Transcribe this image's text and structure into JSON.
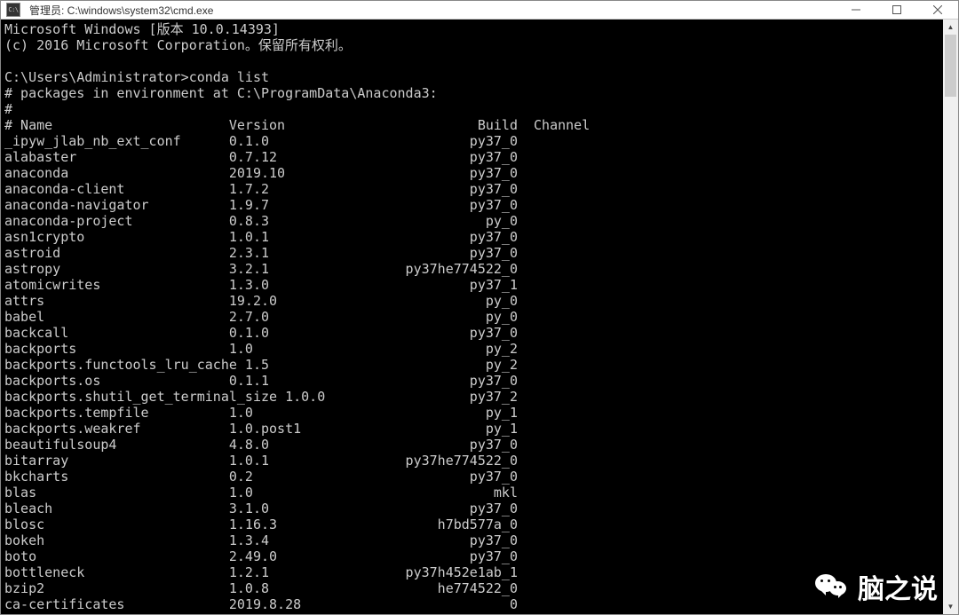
{
  "titlebar": {
    "icon_label": "C:\\",
    "title": "管理员: C:\\windows\\system32\\cmd.exe"
  },
  "terminal": {
    "banner_line1": "Microsoft Windows [版本 10.0.14393]",
    "banner_line2": "(c) 2016 Microsoft Corporation。保留所有权利。",
    "prompt": "C:\\Users\\Administrator>",
    "command": "conda list",
    "env_header": "# packages in environment at C:\\ProgramData\\Anaconda3:",
    "hash": "#",
    "col_name": "# Name",
    "col_version": "Version",
    "col_build": "Build",
    "col_channel": "Channel",
    "packages": [
      {
        "name": "_ipyw_jlab_nb_ext_conf",
        "version": "0.1.0",
        "build": "py37_0"
      },
      {
        "name": "alabaster",
        "version": "0.7.12",
        "build": "py37_0"
      },
      {
        "name": "anaconda",
        "version": "2019.10",
        "build": "py37_0"
      },
      {
        "name": "anaconda-client",
        "version": "1.7.2",
        "build": "py37_0"
      },
      {
        "name": "anaconda-navigator",
        "version": "1.9.7",
        "build": "py37_0"
      },
      {
        "name": "anaconda-project",
        "version": "0.8.3",
        "build": "py_0"
      },
      {
        "name": "asn1crypto",
        "version": "1.0.1",
        "build": "py37_0"
      },
      {
        "name": "astroid",
        "version": "2.3.1",
        "build": "py37_0"
      },
      {
        "name": "astropy",
        "version": "3.2.1",
        "build": "py37he774522_0"
      },
      {
        "name": "atomicwrites",
        "version": "1.3.0",
        "build": "py37_1"
      },
      {
        "name": "attrs",
        "version": "19.2.0",
        "build": "py_0"
      },
      {
        "name": "babel",
        "version": "2.7.0",
        "build": "py_0"
      },
      {
        "name": "backcall",
        "version": "0.1.0",
        "build": "py37_0"
      },
      {
        "name": "backports",
        "version": "1.0",
        "build": "py_2"
      },
      {
        "name": "backports.functools_lru_cache",
        "version": "1.5",
        "build": "py_2"
      },
      {
        "name": "backports.os",
        "version": "0.1.1",
        "build": "py37_0"
      },
      {
        "name": "backports.shutil_get_terminal_size",
        "version": "1.0.0",
        "build": "py37_2"
      },
      {
        "name": "backports.tempfile",
        "version": "1.0",
        "build": "py_1"
      },
      {
        "name": "backports.weakref",
        "version": "1.0.post1",
        "build": "py_1"
      },
      {
        "name": "beautifulsoup4",
        "version": "4.8.0",
        "build": "py37_0"
      },
      {
        "name": "bitarray",
        "version": "1.0.1",
        "build": "py37he774522_0"
      },
      {
        "name": "bkcharts",
        "version": "0.2",
        "build": "py37_0"
      },
      {
        "name": "blas",
        "version": "1.0",
        "build": "mkl"
      },
      {
        "name": "bleach",
        "version": "3.1.0",
        "build": "py37_0"
      },
      {
        "name": "blosc",
        "version": "1.16.3",
        "build": "h7bd577a_0"
      },
      {
        "name": "bokeh",
        "version": "1.3.4",
        "build": "py37_0"
      },
      {
        "name": "boto",
        "version": "2.49.0",
        "build": "py37_0"
      },
      {
        "name": "bottleneck",
        "version": "1.2.1",
        "build": "py37h452e1ab_1"
      },
      {
        "name": "bzip2",
        "version": "1.0.8",
        "build": "he774522_0"
      },
      {
        "name": "ca-certificates",
        "version": "2019.8.28",
        "build": "0"
      }
    ]
  },
  "watermark": {
    "text": "脑之说"
  }
}
